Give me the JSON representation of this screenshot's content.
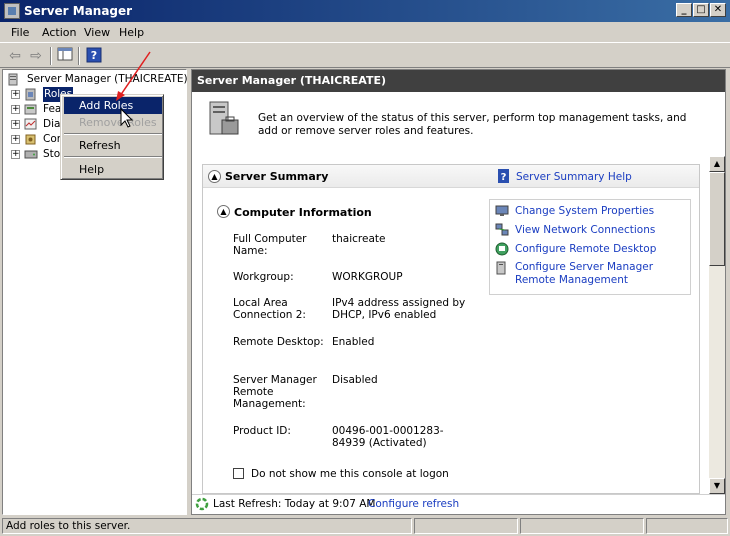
{
  "window": {
    "title": "Server Manager"
  },
  "menu": {
    "file": "File",
    "action": "Action",
    "view": "View",
    "help": "Help"
  },
  "tree": {
    "root": "Server Manager (THAICREATE)",
    "items": [
      "Roles",
      "Features",
      "Diagnostics",
      "Configuration",
      "Storage"
    ],
    "visible_labels": [
      "Roles",
      "Fea",
      "Diag",
      "Con",
      "Sto"
    ]
  },
  "context_menu": {
    "add_roles": "Add Roles",
    "remove_roles": "Remove Roles",
    "refresh": "Refresh",
    "help": "Help"
  },
  "main": {
    "header": "Server Manager (THAICREATE)",
    "intro": "Get an overview of the status of this server, perform top management tasks, and add or remove server roles and features.",
    "summary_title": "Server Summary",
    "summary_help": "Server Summary Help",
    "computer_info_title": "Computer Information",
    "properties": [
      {
        "label": "Full Computer Name:",
        "value": "thaicreate"
      },
      {
        "label": "Workgroup:",
        "value": "WORKGROUP"
      },
      {
        "label": "Local Area Connection 2:",
        "value": "IPv4 address assigned by DHCP, IPv6 enabled"
      },
      {
        "label": "Remote Desktop:",
        "value": "Enabled"
      },
      {
        "label": "Server Manager Remote Management:",
        "value": "Disabled"
      },
      {
        "label": "Product ID:",
        "value": "00496-001-0001283-84939 (Activated)"
      }
    ],
    "tasks": [
      "Change System Properties",
      "View Network Connections",
      "Configure Remote Desktop",
      "Configure Server Manager Remote Management"
    ],
    "logon_checkbox": "Do not show me this console at logon",
    "last_refresh": "Last Refresh: Today at 9:07 AM",
    "configure_refresh": "Configure refresh"
  },
  "status": {
    "text": "Add roles to this server."
  },
  "colors": {
    "title_bar": "#0a246a",
    "header_bar": "#404040",
    "link": "#1a3dc1",
    "selection": "#0a246a"
  }
}
